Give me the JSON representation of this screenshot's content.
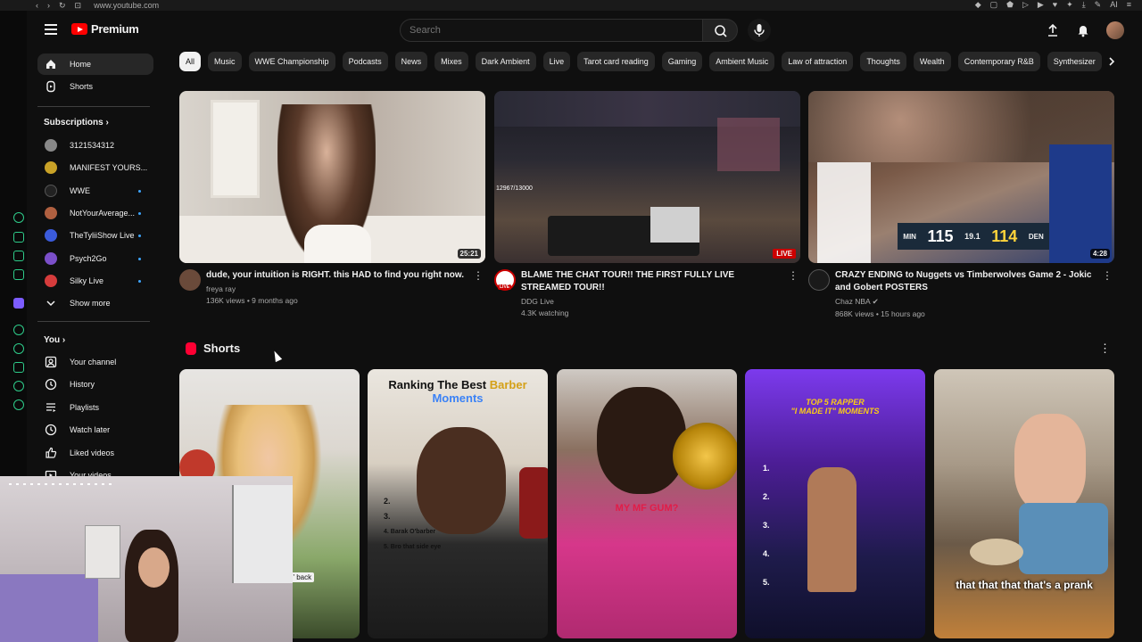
{
  "browser": {
    "url": "www.youtube.com"
  },
  "header": {
    "logo_text": "Premium",
    "search_placeholder": "Search"
  },
  "sidebar": {
    "main": [
      {
        "label": "Home",
        "icon": "home-icon",
        "active": true
      },
      {
        "label": "Shorts",
        "icon": "shorts-icon"
      }
    ],
    "subscriptions_title": "Subscriptions",
    "subscriptions": [
      {
        "label": "3121534312",
        "dot": false,
        "color": "#888888"
      },
      {
        "label": "MANIFEST YOURS...",
        "dot": false,
        "color": "#c9a227"
      },
      {
        "label": "WWE",
        "dot": true,
        "color": "#222222"
      },
      {
        "label": "NotYourAverage...",
        "dot": true,
        "color": "#b06040"
      },
      {
        "label": "TheTyliiShow Live",
        "dot": true,
        "color": "#3b5bdb"
      },
      {
        "label": "Psych2Go",
        "dot": true,
        "color": "#7b4fc9"
      },
      {
        "label": "Silky Live",
        "dot": true,
        "color": "#d63c3c"
      }
    ],
    "show_more": "Show more",
    "you_title": "You",
    "you_items": [
      {
        "label": "Your channel",
        "icon": "user-icon"
      },
      {
        "label": "History",
        "icon": "history-icon"
      },
      {
        "label": "Playlists",
        "icon": "playlist-icon"
      },
      {
        "label": "Watch later",
        "icon": "clock-icon"
      },
      {
        "label": "Liked videos",
        "icon": "thumbs-up-icon"
      },
      {
        "label": "Your videos",
        "icon": "video-icon"
      }
    ]
  },
  "chips": [
    "All",
    "Music",
    "WWE Championship",
    "Podcasts",
    "News",
    "Mixes",
    "Dark Ambient",
    "Live",
    "Tarot card reading",
    "Gaming",
    "Ambient Music",
    "Law of attraction",
    "Thoughts",
    "Wealth",
    "Contemporary R&B",
    "Synthesizer"
  ],
  "videos": [
    {
      "title": "dude, your intuition is RIGHT. this HAD to find you right now.",
      "channel": "freya ray",
      "stats": "136K views • 9 months ago",
      "duration": "25:21"
    },
    {
      "title": "BLAME THE CHAT TOUR!! THE FIRST FULLY LIVE STREAMED TOUR!!",
      "channel": "DDG Live",
      "stats": "4.3K watching",
      "live": "LIVE",
      "avatar_live": "LIVE",
      "overlay_count": "12967/13000"
    },
    {
      "title": "CRAZY ENDING to Nuggets vs Timberwolves Game 2 - Jokic and Gobert POSTERS",
      "channel": "Chaz NBA",
      "stats": "868K views • 15 hours ago",
      "duration": "4:28",
      "score_left": "115",
      "score_right": "114",
      "team_left": "MIN",
      "team_right": "DEN",
      "clock": "19.1"
    }
  ],
  "shorts": {
    "title": "Shorts",
    "items": [
      {
        "caption": "u' back"
      },
      {
        "caption_line1": "Ranking The Best",
        "caption_hl1": "Barber",
        "caption_line2": "Moments",
        "list": [
          "2.",
          "3.",
          "4. Barak O'barber",
          "5. Bro that side eye"
        ]
      },
      {
        "caption": "MY MF GUM?"
      },
      {
        "caption_line1": "TOP 5 RAPPER",
        "caption_line2": "\"I MADE IT\" MOMENTS",
        "list": [
          "1.",
          "2.",
          "3.",
          "4.",
          "5."
        ]
      },
      {
        "caption": "that that that that's a prank"
      }
    ]
  }
}
